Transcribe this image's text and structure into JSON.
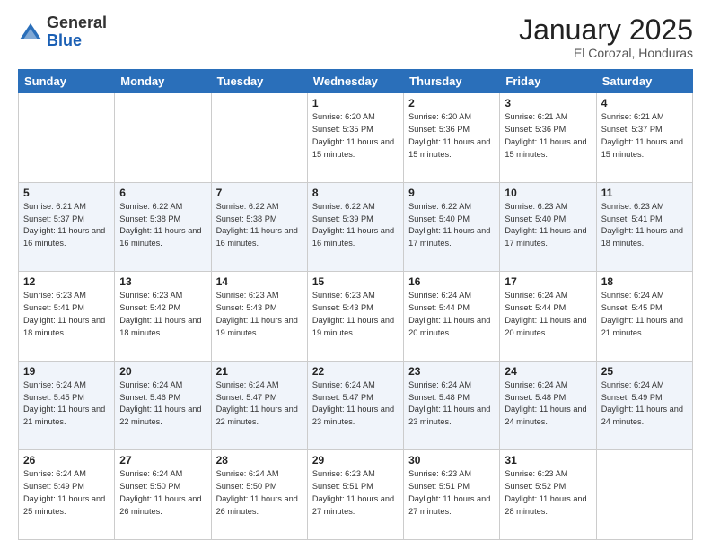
{
  "header": {
    "logo_general": "General",
    "logo_blue": "Blue",
    "month_title": "January 2025",
    "location": "El Corozal, Honduras"
  },
  "weekdays": [
    "Sunday",
    "Monday",
    "Tuesday",
    "Wednesday",
    "Thursday",
    "Friday",
    "Saturday"
  ],
  "weeks": [
    [
      {
        "day": "",
        "sunrise": "",
        "sunset": "",
        "daylight": ""
      },
      {
        "day": "",
        "sunrise": "",
        "sunset": "",
        "daylight": ""
      },
      {
        "day": "",
        "sunrise": "",
        "sunset": "",
        "daylight": ""
      },
      {
        "day": "1",
        "sunrise": "Sunrise: 6:20 AM",
        "sunset": "Sunset: 5:35 PM",
        "daylight": "Daylight: 11 hours and 15 minutes."
      },
      {
        "day": "2",
        "sunrise": "Sunrise: 6:20 AM",
        "sunset": "Sunset: 5:36 PM",
        "daylight": "Daylight: 11 hours and 15 minutes."
      },
      {
        "day": "3",
        "sunrise": "Sunrise: 6:21 AM",
        "sunset": "Sunset: 5:36 PM",
        "daylight": "Daylight: 11 hours and 15 minutes."
      },
      {
        "day": "4",
        "sunrise": "Sunrise: 6:21 AM",
        "sunset": "Sunset: 5:37 PM",
        "daylight": "Daylight: 11 hours and 15 minutes."
      }
    ],
    [
      {
        "day": "5",
        "sunrise": "Sunrise: 6:21 AM",
        "sunset": "Sunset: 5:37 PM",
        "daylight": "Daylight: 11 hours and 16 minutes."
      },
      {
        "day": "6",
        "sunrise": "Sunrise: 6:22 AM",
        "sunset": "Sunset: 5:38 PM",
        "daylight": "Daylight: 11 hours and 16 minutes."
      },
      {
        "day": "7",
        "sunrise": "Sunrise: 6:22 AM",
        "sunset": "Sunset: 5:38 PM",
        "daylight": "Daylight: 11 hours and 16 minutes."
      },
      {
        "day": "8",
        "sunrise": "Sunrise: 6:22 AM",
        "sunset": "Sunset: 5:39 PM",
        "daylight": "Daylight: 11 hours and 16 minutes."
      },
      {
        "day": "9",
        "sunrise": "Sunrise: 6:22 AM",
        "sunset": "Sunset: 5:40 PM",
        "daylight": "Daylight: 11 hours and 17 minutes."
      },
      {
        "day": "10",
        "sunrise": "Sunrise: 6:23 AM",
        "sunset": "Sunset: 5:40 PM",
        "daylight": "Daylight: 11 hours and 17 minutes."
      },
      {
        "day": "11",
        "sunrise": "Sunrise: 6:23 AM",
        "sunset": "Sunset: 5:41 PM",
        "daylight": "Daylight: 11 hours and 18 minutes."
      }
    ],
    [
      {
        "day": "12",
        "sunrise": "Sunrise: 6:23 AM",
        "sunset": "Sunset: 5:41 PM",
        "daylight": "Daylight: 11 hours and 18 minutes."
      },
      {
        "day": "13",
        "sunrise": "Sunrise: 6:23 AM",
        "sunset": "Sunset: 5:42 PM",
        "daylight": "Daylight: 11 hours and 18 minutes."
      },
      {
        "day": "14",
        "sunrise": "Sunrise: 6:23 AM",
        "sunset": "Sunset: 5:43 PM",
        "daylight": "Daylight: 11 hours and 19 minutes."
      },
      {
        "day": "15",
        "sunrise": "Sunrise: 6:23 AM",
        "sunset": "Sunset: 5:43 PM",
        "daylight": "Daylight: 11 hours and 19 minutes."
      },
      {
        "day": "16",
        "sunrise": "Sunrise: 6:24 AM",
        "sunset": "Sunset: 5:44 PM",
        "daylight": "Daylight: 11 hours and 20 minutes."
      },
      {
        "day": "17",
        "sunrise": "Sunrise: 6:24 AM",
        "sunset": "Sunset: 5:44 PM",
        "daylight": "Daylight: 11 hours and 20 minutes."
      },
      {
        "day": "18",
        "sunrise": "Sunrise: 6:24 AM",
        "sunset": "Sunset: 5:45 PM",
        "daylight": "Daylight: 11 hours and 21 minutes."
      }
    ],
    [
      {
        "day": "19",
        "sunrise": "Sunrise: 6:24 AM",
        "sunset": "Sunset: 5:45 PM",
        "daylight": "Daylight: 11 hours and 21 minutes."
      },
      {
        "day": "20",
        "sunrise": "Sunrise: 6:24 AM",
        "sunset": "Sunset: 5:46 PM",
        "daylight": "Daylight: 11 hours and 22 minutes."
      },
      {
        "day": "21",
        "sunrise": "Sunrise: 6:24 AM",
        "sunset": "Sunset: 5:47 PM",
        "daylight": "Daylight: 11 hours and 22 minutes."
      },
      {
        "day": "22",
        "sunrise": "Sunrise: 6:24 AM",
        "sunset": "Sunset: 5:47 PM",
        "daylight": "Daylight: 11 hours and 23 minutes."
      },
      {
        "day": "23",
        "sunrise": "Sunrise: 6:24 AM",
        "sunset": "Sunset: 5:48 PM",
        "daylight": "Daylight: 11 hours and 23 minutes."
      },
      {
        "day": "24",
        "sunrise": "Sunrise: 6:24 AM",
        "sunset": "Sunset: 5:48 PM",
        "daylight": "Daylight: 11 hours and 24 minutes."
      },
      {
        "day": "25",
        "sunrise": "Sunrise: 6:24 AM",
        "sunset": "Sunset: 5:49 PM",
        "daylight": "Daylight: 11 hours and 24 minutes."
      }
    ],
    [
      {
        "day": "26",
        "sunrise": "Sunrise: 6:24 AM",
        "sunset": "Sunset: 5:49 PM",
        "daylight": "Daylight: 11 hours and 25 minutes."
      },
      {
        "day": "27",
        "sunrise": "Sunrise: 6:24 AM",
        "sunset": "Sunset: 5:50 PM",
        "daylight": "Daylight: 11 hours and 26 minutes."
      },
      {
        "day": "28",
        "sunrise": "Sunrise: 6:24 AM",
        "sunset": "Sunset: 5:50 PM",
        "daylight": "Daylight: 11 hours and 26 minutes."
      },
      {
        "day": "29",
        "sunrise": "Sunrise: 6:23 AM",
        "sunset": "Sunset: 5:51 PM",
        "daylight": "Daylight: 11 hours and 27 minutes."
      },
      {
        "day": "30",
        "sunrise": "Sunrise: 6:23 AM",
        "sunset": "Sunset: 5:51 PM",
        "daylight": "Daylight: 11 hours and 27 minutes."
      },
      {
        "day": "31",
        "sunrise": "Sunrise: 6:23 AM",
        "sunset": "Sunset: 5:52 PM",
        "daylight": "Daylight: 11 hours and 28 minutes."
      },
      {
        "day": "",
        "sunrise": "",
        "sunset": "",
        "daylight": ""
      }
    ]
  ]
}
